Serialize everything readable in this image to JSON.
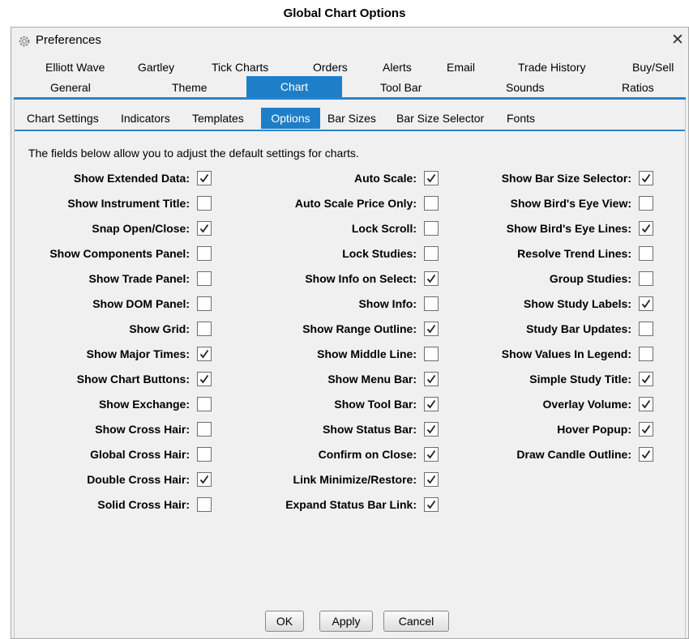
{
  "document_title": "Global Chart Options",
  "window": {
    "icon": "gear-icon",
    "title": "Preferences",
    "close_label": "✕"
  },
  "tabs_row1": [
    "Elliott Wave",
    "Gartley",
    "Tick Charts",
    "Orders",
    "Alerts",
    "Email",
    "Trade History",
    "Buy/Sell"
  ],
  "tabs_row2": [
    "General",
    "Theme",
    "Chart",
    "Tool Bar",
    "Sounds",
    "Ratios"
  ],
  "active_tab": "Chart",
  "subtabs": [
    "Chart Settings",
    "Indicators",
    "Templates",
    "Options",
    "Bar Sizes",
    "Bar Size Selector",
    "Fonts"
  ],
  "active_subtab": "Options",
  "intro": "The fields below allow you to adjust the default settings for charts.",
  "options": {
    "col1": [
      {
        "label": "Show Extended Data:",
        "checked": true
      },
      {
        "label": "Show Instrument Title:",
        "checked": false
      },
      {
        "label": "Snap Open/Close:",
        "checked": true
      },
      {
        "label": "Show Components Panel:",
        "checked": false
      },
      {
        "label": "Show Trade Panel:",
        "checked": false
      },
      {
        "label": "Show DOM Panel:",
        "checked": false
      },
      {
        "label": "Show Grid:",
        "checked": false
      },
      {
        "label": "Show Major Times:",
        "checked": true
      },
      {
        "label": "Show Chart Buttons:",
        "checked": true
      },
      {
        "label": "Show Exchange:",
        "checked": false
      },
      {
        "label": "Show Cross Hair:",
        "checked": false
      },
      {
        "label": "Global Cross Hair:",
        "checked": false
      },
      {
        "label": "Double Cross Hair:",
        "checked": true
      },
      {
        "label": "Solid Cross Hair:",
        "checked": false
      }
    ],
    "col2": [
      {
        "label": "Auto Scale:",
        "checked": true
      },
      {
        "label": "Auto Scale Price Only:",
        "checked": false
      },
      {
        "label": "Lock Scroll:",
        "checked": false
      },
      {
        "label": "Lock Studies:",
        "checked": false
      },
      {
        "label": "Show Info on Select:",
        "checked": true
      },
      {
        "label": "Show Info:",
        "checked": false
      },
      {
        "label": "Show Range Outline:",
        "checked": true
      },
      {
        "label": "Show Middle Line:",
        "checked": false
      },
      {
        "label": "Show Menu Bar:",
        "checked": true
      },
      {
        "label": "Show Tool Bar:",
        "checked": true
      },
      {
        "label": "Show Status Bar:",
        "checked": true
      },
      {
        "label": "Confirm on Close:",
        "checked": true
      },
      {
        "label": "Link Minimize/Restore:",
        "checked": true
      },
      {
        "label": "Expand Status Bar Link:",
        "checked": true
      }
    ],
    "col3": [
      {
        "label": "Show Bar Size Selector:",
        "checked": true
      },
      {
        "label": "Show Bird's Eye View:",
        "checked": false
      },
      {
        "label": "Show Bird's Eye Lines:",
        "checked": true
      },
      {
        "label": "Resolve Trend Lines:",
        "checked": false
      },
      {
        "label": "Group Studies:",
        "checked": false
      },
      {
        "label": "Show Study Labels:",
        "checked": true
      },
      {
        "label": "Study Bar Updates:",
        "checked": false
      },
      {
        "label": "Show Values In Legend:",
        "checked": false
      },
      {
        "label": "Simple Study Title:",
        "checked": true
      },
      {
        "label": "Overlay Volume:",
        "checked": true
      },
      {
        "label": "Hover Popup:",
        "checked": true
      },
      {
        "label": "Draw Candle Outline:",
        "checked": true
      }
    ]
  },
  "buttons": {
    "ok": "OK",
    "apply": "Apply",
    "cancel": "Cancel"
  },
  "colors": {
    "accent": "#1f7ec8",
    "panel_bg": "#f0f0f0"
  }
}
